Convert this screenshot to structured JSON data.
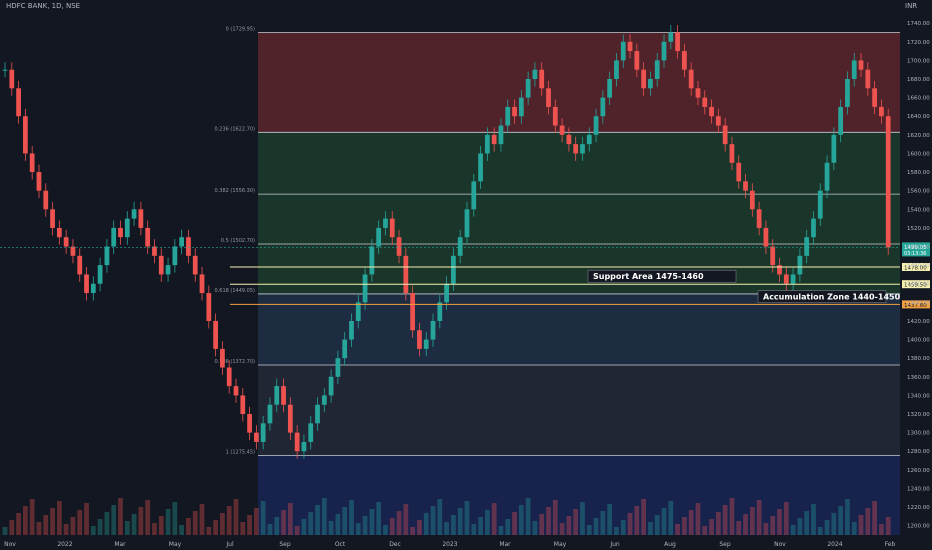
{
  "header": {
    "symbol": "HDFC BANK, 1D, NSE",
    "currency": "INR"
  },
  "colors": {
    "background": "#131722",
    "up": "#26a69a",
    "down": "#ef5350",
    "fib_top": "#7a2a30",
    "fib_mid": "#1f4a30",
    "fib_low": "#243a55",
    "fib_bottom": "#1a2a6a"
  },
  "chart_data": {
    "type": "candlestick",
    "title": "HDFC BANK, 1D, NSE",
    "x_tick_labels": [
      "Nov",
      "2022",
      "Mar",
      "May",
      "Jul",
      "Sep",
      "Oct",
      "Dec",
      "2023",
      "Mar",
      "May",
      "Jun",
      "Aug",
      "Sep",
      "Nov",
      "2024",
      "Feb"
    ],
    "y_ticks": [
      1200,
      1220,
      1240,
      1260,
      1280,
      1300,
      1320,
      1340,
      1360,
      1380,
      1400,
      1420,
      1440,
      1460,
      1480,
      1500,
      1520,
      1540,
      1560,
      1580,
      1600,
      1620,
      1640,
      1660,
      1680,
      1700,
      1720,
      1740
    ],
    "y_tick_labels": [
      "1200.00",
      "1220.00",
      "1240.00",
      "1260.00",
      "1280.00",
      "1300.00",
      "1320.00",
      "1340.00",
      "1360.00",
      "1380.00",
      "1400.00",
      "1420.00",
      "1440.00",
      "1460.00",
      "1480.00",
      "1500.00",
      "1520.00",
      "1540.00",
      "1560.00",
      "1580.00",
      "1600.00",
      "1620.00",
      "1640.00",
      "1660.00",
      "1680.00",
      "1700.00",
      "1720.00",
      "1740.00"
    ],
    "ylim": [
      1190,
      1752
    ],
    "fib_levels": [
      {
        "label": "0 (1729.95)",
        "value": 1729.95
      },
      {
        "label": "0.236 (1622.70)",
        "value": 1622.7
      },
      {
        "label": "0.382 (1556.30)",
        "value": 1556.3
      },
      {
        "label": "0.5 (1502.70)",
        "value": 1502.7
      },
      {
        "label": "0.618 (1449.05)",
        "value": 1449.05
      },
      {
        "label": "0.786 (1372.70)",
        "value": 1372.7
      },
      {
        "label": "1 (1275.45)",
        "value": 1275.45
      }
    ],
    "annotations": [
      {
        "text": "Support Area 1475-1460",
        "level": 1467
      },
      {
        "text": "Accumulation Zone 1440-1450",
        "level": 1445
      }
    ],
    "horizontal_lines": [
      {
        "value": 1478.0,
        "label": "1478.00",
        "color": "#f5f0b0"
      },
      {
        "value": 1459.5,
        "label": "1459.50",
        "color": "#f5f0b0"
      },
      {
        "value": 1437.8,
        "label": "1437.80",
        "color": "#f0a040"
      }
    ],
    "last_price": {
      "value": 1499.05,
      "label": "1499.05",
      "countdown": "03:13:36"
    },
    "series": [
      {
        "name": "close",
        "values": [
          1690,
          1670,
          1640,
          1600,
          1580,
          1560,
          1540,
          1520,
          1510,
          1500,
          1490,
          1470,
          1450,
          1460,
          1480,
          1500,
          1520,
          1510,
          1530,
          1540,
          1520,
          1500,
          1490,
          1470,
          1480,
          1500,
          1510,
          1490,
          1470,
          1450,
          1420,
          1390,
          1370,
          1350,
          1340,
          1320,
          1300,
          1290,
          1310,
          1330,
          1350,
          1330,
          1300,
          1280,
          1290,
          1310,
          1330,
          1340,
          1360,
          1380,
          1400,
          1420,
          1440,
          1470,
          1500,
          1520,
          1530,
          1510,
          1490,
          1450,
          1410,
          1390,
          1400,
          1420,
          1440,
          1460,
          1490,
          1510,
          1540,
          1570,
          1600,
          1620,
          1610,
          1630,
          1650,
          1640,
          1660,
          1680,
          1690,
          1670,
          1650,
          1630,
          1620,
          1610,
          1600,
          1610,
          1620,
          1640,
          1660,
          1680,
          1700,
          1720,
          1710,
          1690,
          1670,
          1680,
          1700,
          1720,
          1730,
          1710,
          1690,
          1670,
          1660,
          1650,
          1640,
          1630,
          1610,
          1590,
          1570,
          1560,
          1540,
          1520,
          1500,
          1480,
          1470,
          1460,
          1470,
          1490,
          1510,
          1530,
          1560,
          1590,
          1620,
          1650,
          1680,
          1700,
          1690,
          1670,
          1650,
          1640,
          1499
        ]
      }
    ]
  }
}
